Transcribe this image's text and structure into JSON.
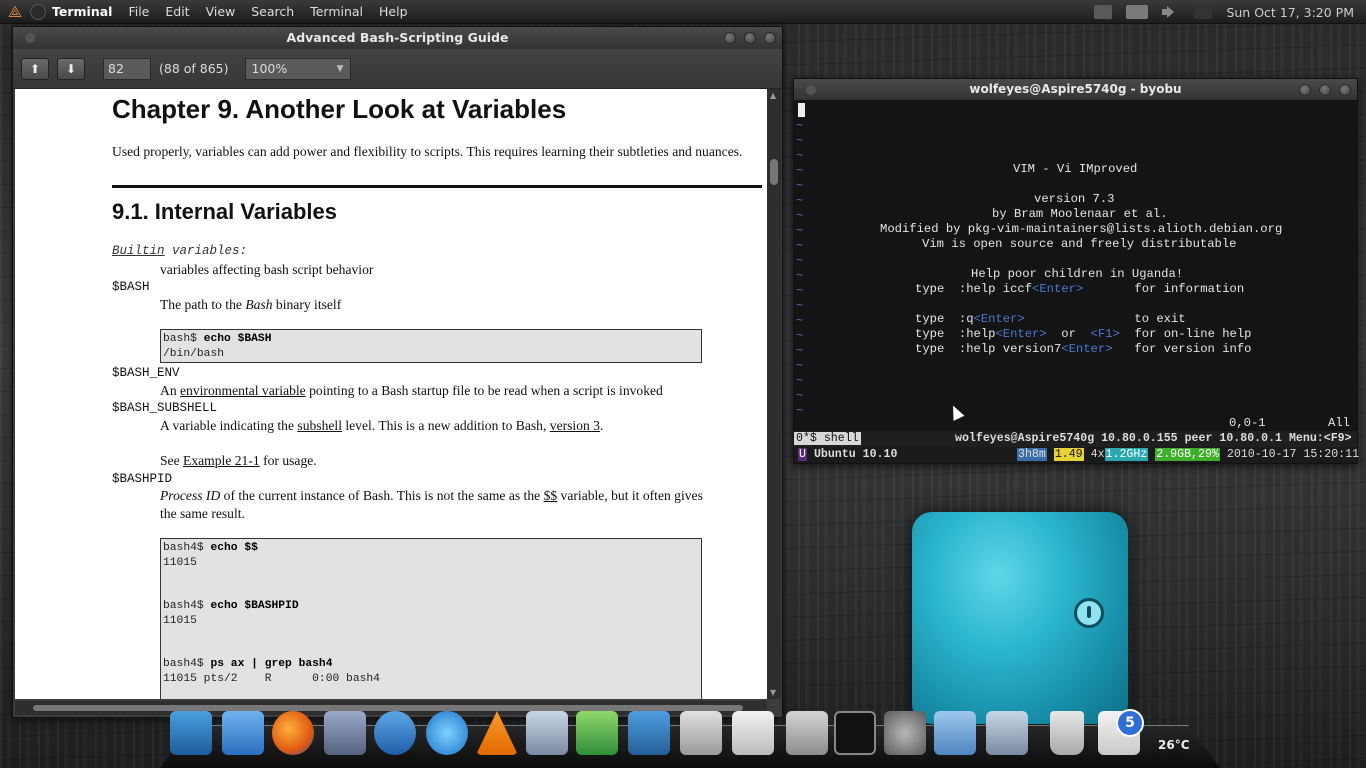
{
  "top_panel": {
    "app_name": "Terminal",
    "menus": [
      "File",
      "Edit",
      "View",
      "Search",
      "Terminal",
      "Help"
    ],
    "clock": "Sun Oct 17,  3:20 PM"
  },
  "pdf": {
    "title": "Advanced Bash-Scripting Guide",
    "page_input": "82",
    "page_of": "(88 of 865)",
    "zoom": "100%",
    "content": {
      "chapter_title": "Chapter 9. Another Look at Variables",
      "intro": "Used properly, variables can add power and flexibility to scripts. This requires learning their subtleties and nuances.",
      "section_title": "9.1. Internal Variables",
      "builtin": "Builtin",
      "builtin_rest": " variables:",
      "builtin_desc": "variables affecting bash script behavior",
      "v1": "$BASH",
      "v1_desc_a": "The path to the ",
      "v1_desc_b": "Bash",
      "v1_desc_c": " binary itself",
      "code1_prompt": "bash$ ",
      "code1_cmd": "echo $BASH",
      "code1_out": "/bin/bash",
      "v2": "$BASH_ENV",
      "v2_desc_a": "An ",
      "v2_desc_link": "environmental variable",
      "v2_desc_b": " pointing to a Bash startup file to be read when a script is invoked",
      "v3": "$BASH_SUBSHELL",
      "v3_desc_a": "A variable indicating the ",
      "v3_desc_link": "subshell",
      "v3_desc_b": " level. This is a new addition to Bash, ",
      "v3_desc_link2": "version 3",
      "v3_desc_c": ".",
      "see_a": "See ",
      "see_link": "Example 21-1",
      "see_b": " for usage.",
      "v4": "$BASHPID",
      "v4_desc_a": "Process ID",
      "v4_desc_b": " of the current instance of Bash. This is not the same as the ",
      "v4_desc_link": "$$",
      "v4_desc_c": " variable, but it often gives",
      "v4_desc_d": "the same result.",
      "code2": [
        {
          "prompt": "bash4$ ",
          "cmd": "echo $$",
          "out": "11015"
        },
        {
          "prompt": "bash4$ ",
          "cmd": "echo $BASHPID",
          "out": "11015"
        },
        {
          "prompt": "bash4$ ",
          "cmd": "ps ax | grep bash4",
          "out": "11015 pts/2    R      0:00 bash4"
        }
      ]
    }
  },
  "terminal": {
    "title": "wolfeyes@Aspire5740g - byobu",
    "vim": {
      "heading": "VIM - Vi IMproved",
      "version": "version 7.3",
      "author": "by Bram Moolenaar et al.",
      "modified": "Modified by pkg-vim-maintainers@lists.alioth.debian.org",
      "license": "Vim is open source and freely distributable",
      "charity": "Help poor children in Uganda!",
      "l1a": "type  :help iccf",
      "l1k": "<Enter>",
      "l1b": "       for information",
      "l2a": "type  :q",
      "l2k": "<Enter>",
      "l2b": "               to exit",
      "l3a": "type  :help",
      "l3k": "<Enter>",
      "l3m": "  or  ",
      "l3k2": "<F1>",
      "l3b": "  for on-line help",
      "l4a": "type  :help version7",
      "l4k": "<Enter>",
      "l4b": "   for version info",
      "ruler": "0,0-1",
      "pos": "All"
    },
    "byobu": {
      "window": "0*$ shell",
      "host": "wolfeyes@Aspire5740g 10.80.0.155 peer ",
      "peer": "10.80.0.1",
      "menu": " Menu:<F9>",
      "u": "U",
      "distro": "Ubuntu 10.10",
      "uptime": "3h8m",
      "load": "1.49",
      "cpu_a": "4x",
      "cpu_b": "1.2GHz",
      "mem": "2.9GB,29%",
      "datetime": "2010-10-17 15:20:11"
    }
  },
  "dock": {
    "mail_badge": "5",
    "temperature": "26°C"
  },
  "colors": {
    "accent_orange": "#e0823c",
    "vim_blue": "#4a79d1",
    "byobu_green": "#3fae2a",
    "byobu_yellow": "#e4d331",
    "byobu_cyan": "#2aa8b0"
  }
}
